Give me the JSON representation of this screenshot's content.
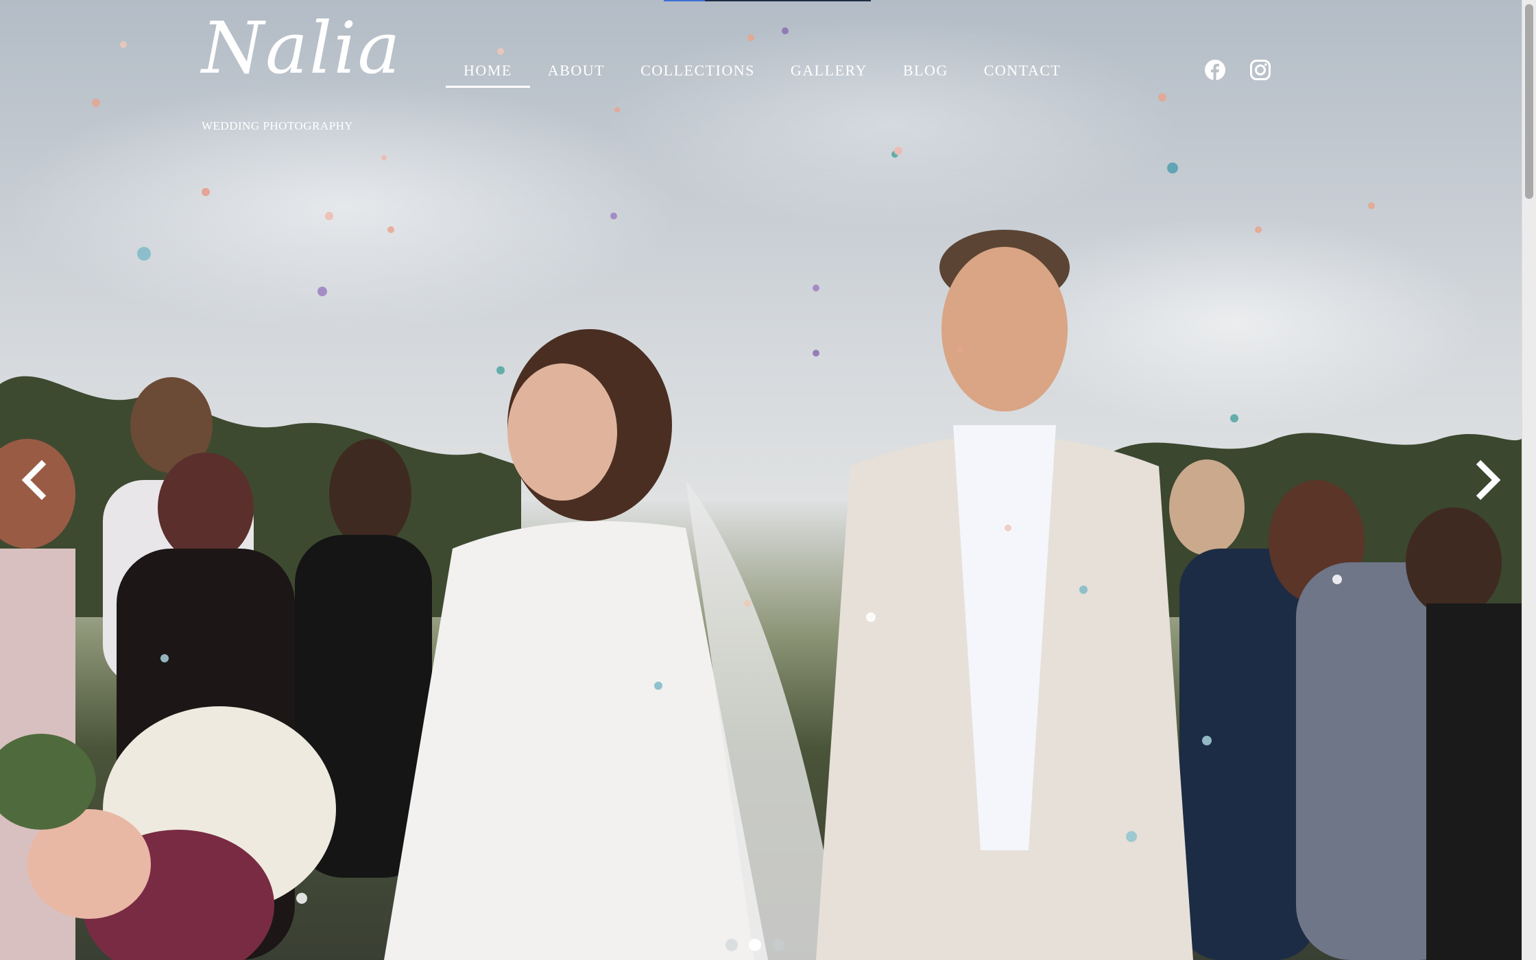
{
  "brand": {
    "logo_script": "Nalia",
    "tagline": "WEDDING PHOTOGRAPHY"
  },
  "nav": {
    "items": [
      {
        "label": "HOME",
        "active": true
      },
      {
        "label": "ABOUT",
        "active": false
      },
      {
        "label": "COLLECTIONS",
        "active": false
      },
      {
        "label": "GALLERY",
        "active": false
      },
      {
        "label": "BLOG",
        "active": false
      },
      {
        "label": "CONTACT",
        "active": false
      }
    ]
  },
  "social": {
    "icons": [
      "facebook-icon",
      "instagram-icon"
    ]
  },
  "slider": {
    "prev_icon": "chevron-left-icon",
    "next_icon": "chevron-right-icon",
    "slide_count": 3,
    "active_slide": 2
  },
  "colors": {
    "nav_text": "#ffffff",
    "accent_progress": "#3d6fd4"
  },
  "page_load_progress": 0.2
}
